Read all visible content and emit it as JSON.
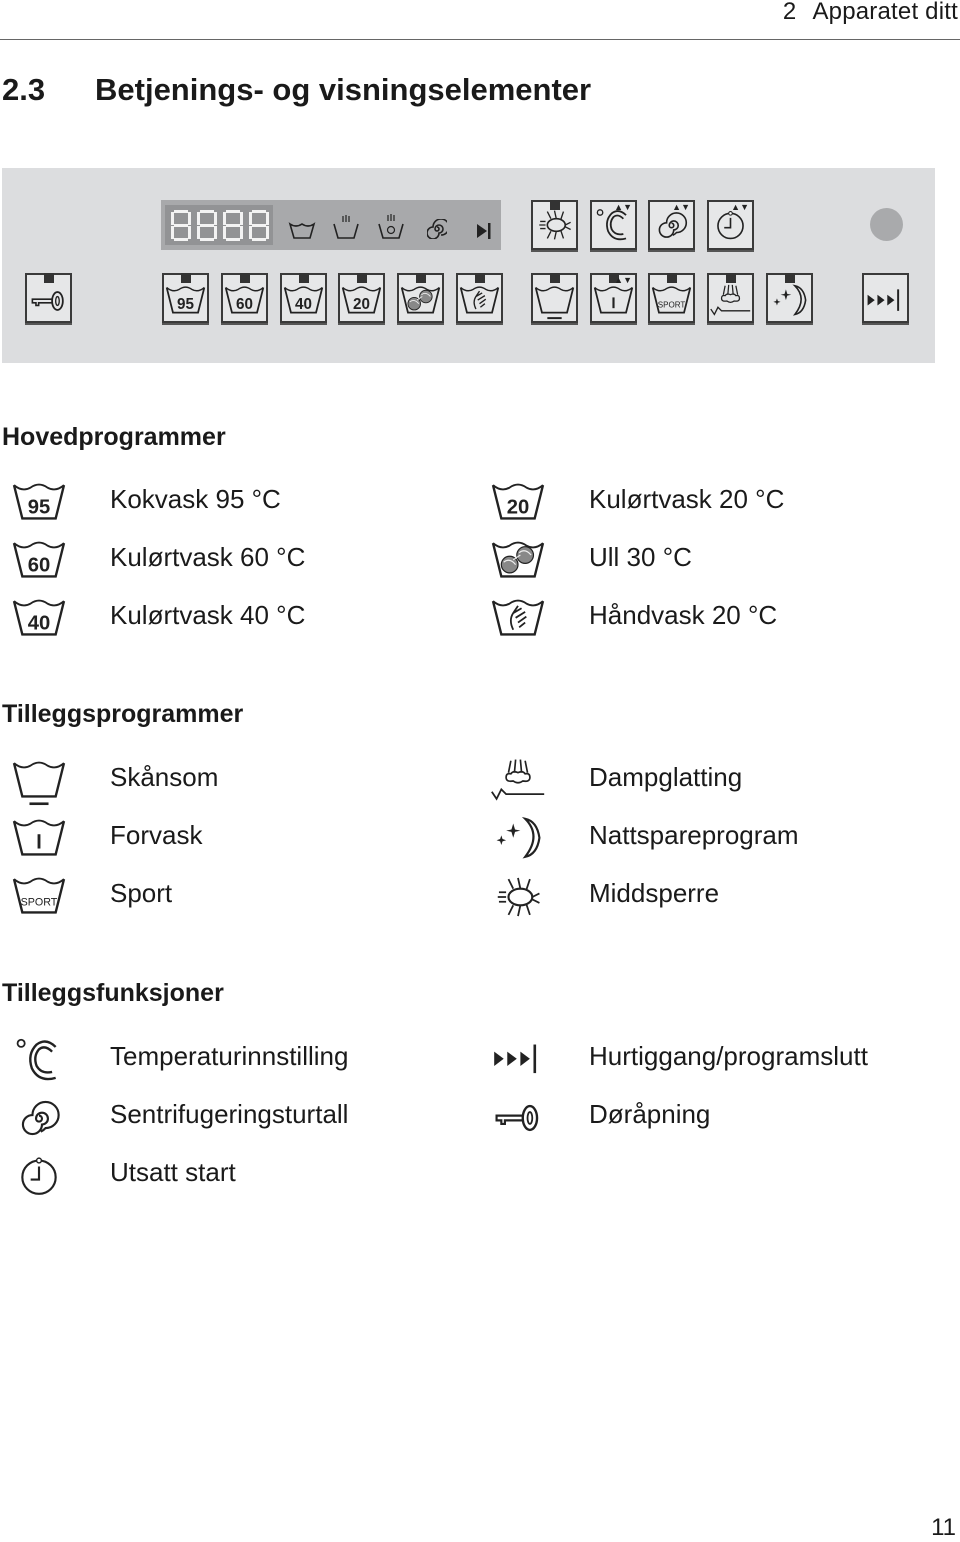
{
  "header": {
    "chapter_number": "2",
    "chapter_title": "Apparatet ditt"
  },
  "section": {
    "number": "2.3",
    "title": "Betjenings- og visningselementer"
  },
  "control_panel": {
    "display_digits": "8888",
    "display_icons": [
      "wash-tub-icon",
      "rinse-icon",
      "softener-rinse-icon",
      "spin-icon",
      "end-icon"
    ],
    "top_buttons": [
      {
        "icon": "mite-icon",
        "has_led": true,
        "has_arrows": false
      },
      {
        "icon": "temperature-icon",
        "has_led": false,
        "has_arrows": true
      },
      {
        "icon": "spin-speed-icon",
        "has_led": false,
        "has_arrows": true
      },
      {
        "icon": "delay-start-icon",
        "has_led": false,
        "has_arrows": true
      }
    ],
    "arrow_glyph": "▲▼",
    "bottom_buttons": [
      {
        "icon": "door-key-icon",
        "label": ""
      },
      {
        "icon": "wash-95-icon",
        "label": "95"
      },
      {
        "icon": "wash-60-icon",
        "label": "60"
      },
      {
        "icon": "wash-40-icon",
        "label": "40"
      },
      {
        "icon": "wash-20-icon",
        "label": "20"
      },
      {
        "icon": "wool-icon",
        "label": ""
      },
      {
        "icon": "handwash-icon",
        "label": ""
      },
      {
        "icon": "gentle-icon",
        "label": ""
      },
      {
        "icon": "prewash-icon",
        "label": ""
      },
      {
        "icon": "sport-icon",
        "label": "SPORT"
      },
      {
        "icon": "steam-icon",
        "label": ""
      },
      {
        "icon": "night-icon",
        "label": ""
      },
      {
        "icon": "fast-forward-icon",
        "label": ""
      }
    ]
  },
  "main_programs": {
    "heading": "Hovedprogrammer",
    "items": [
      {
        "icon": "wash-95-icon",
        "badge": "95",
        "label": "Kokvask 95 °C"
      },
      {
        "icon": "wash-60-icon",
        "badge": "60",
        "label": "Kulørtvask 60 °C"
      },
      {
        "icon": "wash-40-icon",
        "badge": "40",
        "label": "Kulørtvask 40 °C"
      },
      {
        "icon": "wash-20-icon",
        "badge": "20",
        "label": "Kulørtvask 20 °C"
      },
      {
        "icon": "wool-icon",
        "badge": "",
        "label": "Ull 30 °C"
      },
      {
        "icon": "handwash-icon",
        "badge": "",
        "label": "Håndvask 20 °C"
      }
    ]
  },
  "extra_programs": {
    "heading": "Tilleggsprogrammer",
    "items": [
      {
        "icon": "gentle-icon",
        "badge": "",
        "label": "Skånsom"
      },
      {
        "icon": "prewash-icon",
        "badge": "",
        "label": "Forvask"
      },
      {
        "icon": "sport-icon",
        "badge": "SPORT",
        "label": "Sport"
      },
      {
        "icon": "steam-icon",
        "badge": "",
        "label": "Dampglatting"
      },
      {
        "icon": "night-icon",
        "badge": "",
        "label": "Nattspareprogram"
      },
      {
        "icon": "mite-icon",
        "badge": "",
        "label": "Middsperre"
      }
    ]
  },
  "extra_functions": {
    "heading": "Tilleggsfunksjoner",
    "items": [
      {
        "icon": "temperature-icon",
        "label": "Temperaturinnstilling"
      },
      {
        "icon": "spin-speed-icon",
        "label": "Sentrifugeringsturtall"
      },
      {
        "icon": "delay-start-icon",
        "label": "Utsatt start"
      },
      {
        "icon": "fast-forward-icon",
        "label": "Hurtiggang/programslutt"
      },
      {
        "icon": "door-key-icon",
        "label": "Døråpning"
      }
    ]
  },
  "footer": {
    "page_number": "11"
  }
}
